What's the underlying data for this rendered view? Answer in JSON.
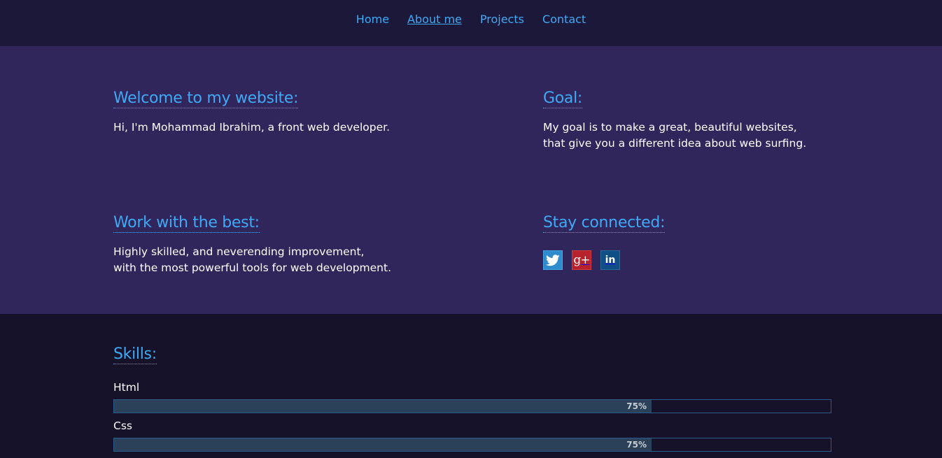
{
  "nav": {
    "items": [
      {
        "label": "Home"
      },
      {
        "label": "About me"
      },
      {
        "label": "Projects"
      },
      {
        "label": "Contact"
      }
    ]
  },
  "about": {
    "welcome": {
      "title": "Welcome to my website:",
      "text": "Hi, I'm Mohammad Ibrahim, a front web developer."
    },
    "goal": {
      "title": "Goal:",
      "line1": "My goal is to make a great, beautiful websites,",
      "line2": "that give you a different idea about web surfing."
    },
    "work": {
      "title": "Work with the best:",
      "line1": "Highly skilled, and neverending improvement,",
      "line2": "with the most powerful tools for web development."
    },
    "connect": {
      "title": "Stay connected:",
      "icons": [
        "twitter-icon",
        "google-plus-icon",
        "linkedin-icon"
      ],
      "gplus_glyph": "g+",
      "linkedin_glyph": "in"
    }
  },
  "skills": {
    "title": "Skills:",
    "items": [
      {
        "name": "Html",
        "value": 75,
        "label": "75%"
      },
      {
        "name": "Css",
        "value": 75,
        "label": "75%"
      }
    ]
  },
  "colors": {
    "accent": "#3fa9f5",
    "nav_bg": "#1c183a",
    "section_bg": "#30265c",
    "skills_bg": "#15122a",
    "bar_fill": "#2a4159",
    "twitter": "#2e8ccd",
    "googleplus": "#b8222d",
    "linkedin": "#0f4f86"
  }
}
